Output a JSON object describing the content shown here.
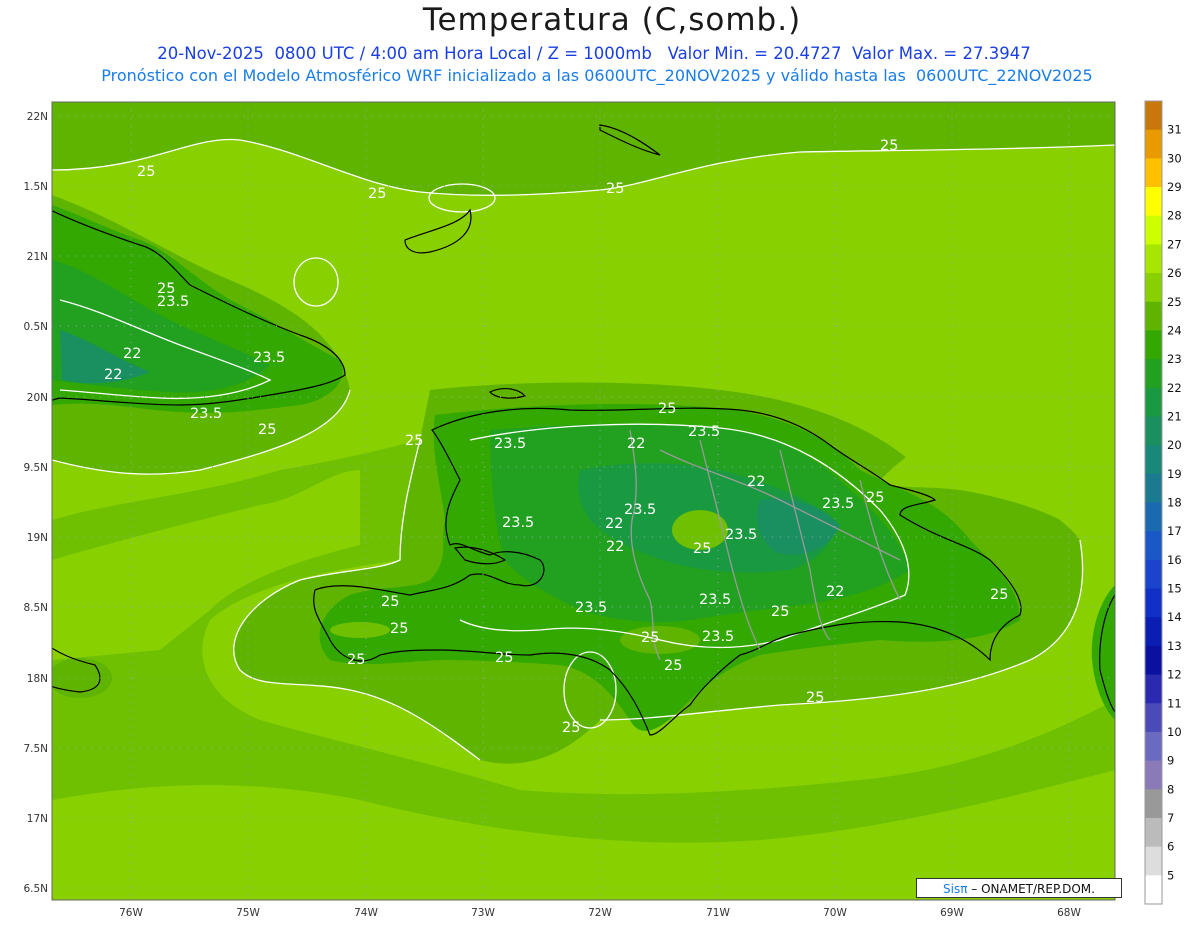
{
  "header": {
    "title": "Temperatura (C,somb.)",
    "date": "20-Nov-2025",
    "time_utc": "0800 UTC",
    "local_time": "4:00 am Hora Local",
    "level": "Z = 1000mb",
    "min_label": "Valor Min. = 20.4727",
    "max_label": "Valor Max. = 27.3947",
    "model_line": "Pronóstico con el Modelo Atmosférico WRF inicializado a las 0600UTC_20NOV2025 y válido hasta las  0600UTC_22NOV2025"
  },
  "axes": {
    "lat_ticks": [
      "22N",
      "1.5N",
      "21N",
      "0.5N",
      "20N",
      "9.5N",
      "19N",
      "8.5N",
      "18N",
      "7.5N",
      "17N",
      "6.5N"
    ],
    "lon_ticks": [
      "76W",
      "75W",
      "74W",
      "73W",
      "72W",
      "71W",
      "70W",
      "69W",
      "68W"
    ]
  },
  "colorbar": {
    "levels": [
      "31",
      "30",
      "29",
      "28",
      "27",
      "26",
      "25",
      "24",
      "23",
      "22",
      "21",
      "20",
      "19",
      "18",
      "17",
      "16",
      "15",
      "14",
      "13",
      "12",
      "11",
      "10",
      "9",
      "8",
      "7",
      "6",
      "5"
    ],
    "colors": {
      "top": [
        "#c8780a",
        "#e89a00",
        "#ffc000",
        "#ffff00",
        "#ccff00",
        "#a6e600",
        "#88d000",
        "#5fb400",
        "#32a800",
        "#22a020",
        "#1a9a40",
        "#1a9060",
        "#188878",
        "#1a7a90",
        "#1a6ab0",
        "#1a58c8",
        "#1a44cc",
        "#1030c8",
        "#0a1eb4",
        "#0a10a0",
        "#2a2ab0",
        "#4a4ab8",
        "#6a6ac0",
        "#8a7ab8",
        "#999999",
        "#bbbbbb",
        "#dddddd",
        "#ffffff"
      ]
    }
  },
  "contour_labels": [
    "25",
    "25",
    "25",
    "25",
    "25",
    "23.5",
    "22",
    "22",
    "23.5",
    "23.5",
    "25",
    "25",
    "23.5",
    "22",
    "23.5",
    "22",
    "23.5",
    "22",
    "23.5",
    "25",
    "25",
    "23.5",
    "22",
    "23.5",
    "25",
    "22",
    "25",
    "25",
    "23.5",
    "25",
    "23.5",
    "25",
    "25",
    "23.5",
    "25",
    "25",
    "25",
    "25",
    "25"
  ],
  "credit": {
    "brand": "Sisπ",
    "org": " – ONAMET/REP.DOM."
  }
}
